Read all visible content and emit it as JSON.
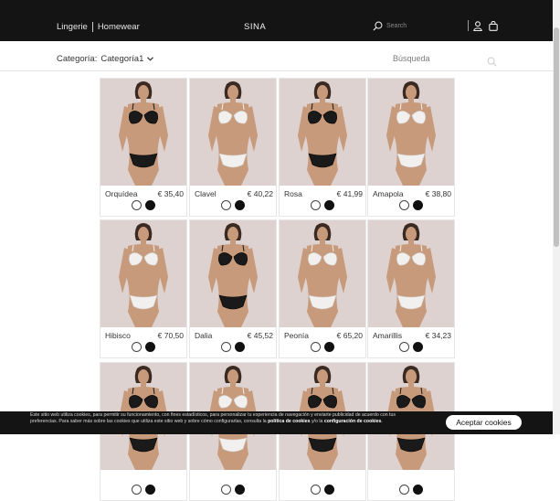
{
  "header": {
    "link_lingerie": "Lingerie",
    "link_homewear": "Homewear",
    "logo": "SINA",
    "search_placeholder": "Search"
  },
  "filters": {
    "category_label": "Categoría:",
    "category_value": "Categoría1",
    "search_label": "Búsqueda"
  },
  "products": [
    {
      "name": "Orquídea",
      "price": "€ 35,40",
      "color": "black"
    },
    {
      "name": "Clavel",
      "price": "€ 40,22",
      "color": "white"
    },
    {
      "name": "Rosa",
      "price": "€ 41,99",
      "color": "black"
    },
    {
      "name": "Amapola",
      "price": "€ 38,80",
      "color": "white"
    },
    {
      "name": "Hibisco",
      "price": "€ 70,50",
      "color": "white"
    },
    {
      "name": "Dalia",
      "price": "€ 45,52",
      "color": "black"
    },
    {
      "name": "Peonía",
      "price": "€ 65,20",
      "color": "white"
    },
    {
      "name": "Amarillis",
      "price": "€ 34,23",
      "color": "white"
    },
    {
      "name": "",
      "price": "",
      "color": "black"
    },
    {
      "name": "",
      "price": "",
      "color": "white"
    },
    {
      "name": "",
      "price": "",
      "color": "black"
    },
    {
      "name": "",
      "price": "",
      "color": "black"
    }
  ],
  "cookie": {
    "text_part1": "Este sitio web utiliza cookies, para permitir su funcionamiento, con fines estadísticos, para personalizar tu experiencia de navegación y enviarte publicidad de acuerdo con tus preferencias. Para saber más sobre las cookies que utiliza este sitio web y sobre cómo configurarlas, consulta la ",
    "link_politica": "política de cookies",
    "text_part2": " y/o la ",
    "link_config": "configuración de cookies",
    "text_part3": ".",
    "accept_label": "Aceptar cookies"
  },
  "colors": {
    "header_bg": "#141414",
    "skin": "#c79a7c",
    "bg_photo": "#ddd2cf",
    "lingerie_black": "#1a1a1a",
    "lingerie_white": "#f2f0ee"
  }
}
